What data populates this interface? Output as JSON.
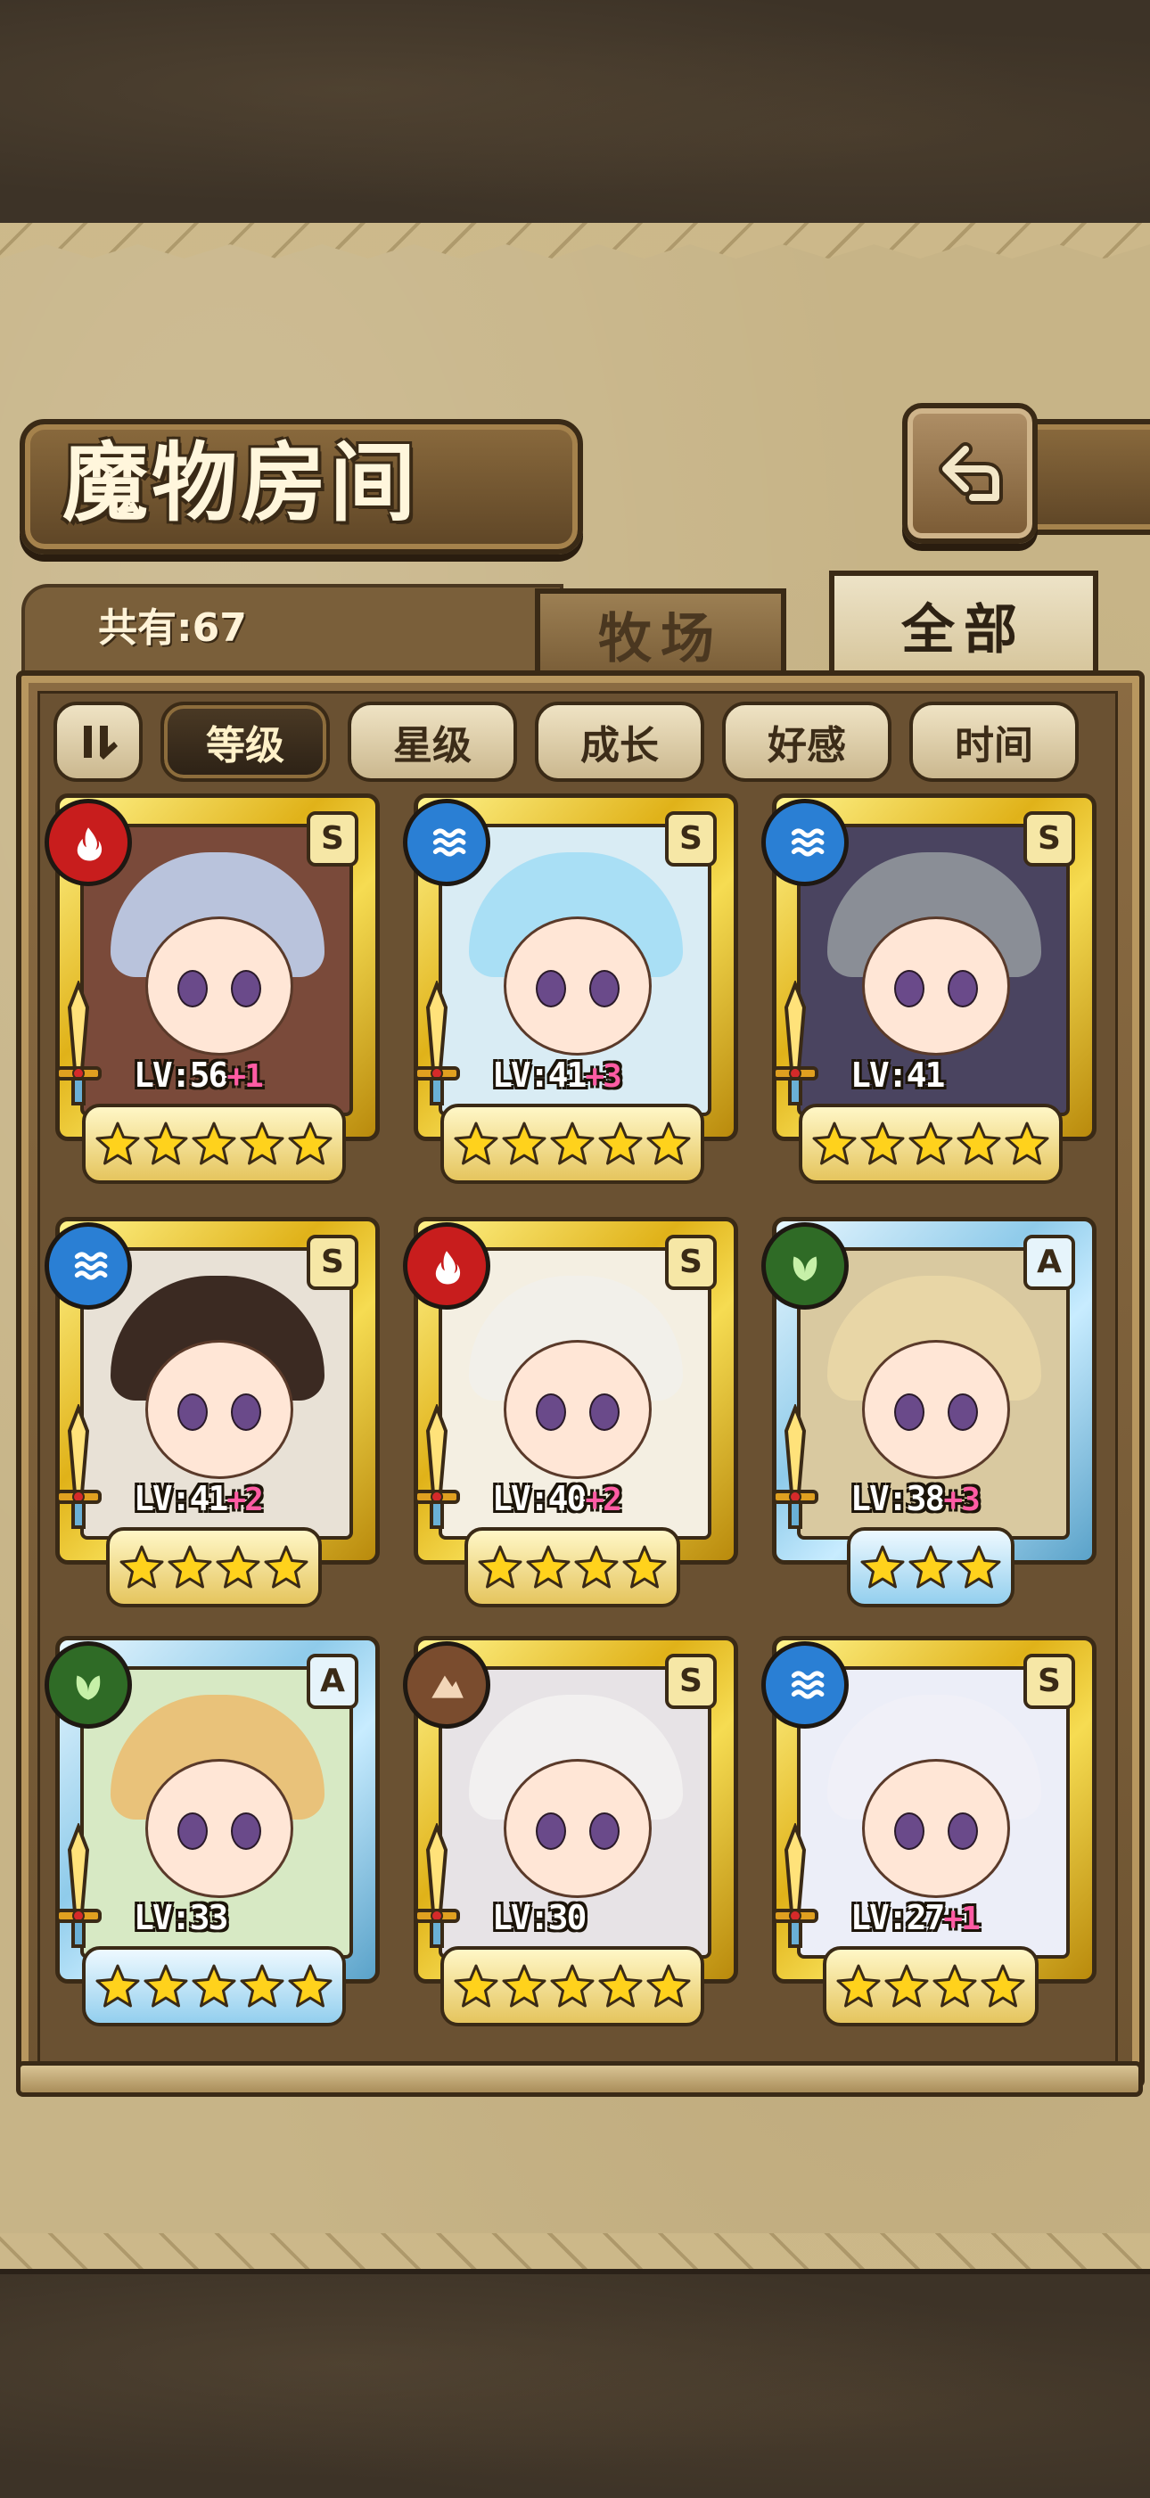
{
  "header": {
    "title": "魔物房间",
    "back_icon": "back-arrow-icon"
  },
  "tabs": [
    {
      "label": "牧场",
      "active": false
    },
    {
      "label": "全部",
      "active": true
    }
  ],
  "count": {
    "label": "共有:67"
  },
  "sort": {
    "toggle_icon": "sort-order-icon",
    "buttons": [
      {
        "label": "等级",
        "active": true
      },
      {
        "label": "星级",
        "active": false
      },
      {
        "label": "成长",
        "active": false
      },
      {
        "label": "好感",
        "active": false
      },
      {
        "label": "时间",
        "active": false
      }
    ]
  },
  "monsters": [
    {
      "element": "fire",
      "rank": "S",
      "lv": "LV:56",
      "plus": "+1",
      "stars": 5,
      "frame": "gold",
      "hair": "#b9c3dc",
      "bg": "#7a4a3a"
    },
    {
      "element": "water",
      "rank": "S",
      "lv": "LV:41",
      "plus": "+3",
      "stars": 5,
      "frame": "gold",
      "hair": "#a9dff5",
      "bg": "#d9ecf4"
    },
    {
      "element": "water",
      "rank": "S",
      "lv": "LV:41",
      "plus": "",
      "stars": 5,
      "frame": "gold",
      "hair": "#8a8e96",
      "bg": "#4a4460"
    },
    {
      "element": "water",
      "rank": "S",
      "lv": "LV:41",
      "plus": "+2",
      "stars": 4,
      "frame": "gold",
      "hair": "#3b2a22",
      "bg": "#e8e1d6"
    },
    {
      "element": "fire",
      "rank": "S",
      "lv": "LV:40",
      "plus": "+2",
      "stars": 4,
      "frame": "gold",
      "hair": "#f2f0ea",
      "bg": "#f4efe2"
    },
    {
      "element": "wood",
      "rank": "A",
      "lv": "LV:38",
      "plus": "+3",
      "stars": 3,
      "frame": "blue",
      "hair": "#e8d6a6",
      "bg": "#d9c9a0"
    },
    {
      "element": "wood",
      "rank": "A",
      "lv": "LV:33",
      "plus": "",
      "stars": 5,
      "frame": "blue",
      "hair": "#e9c27a",
      "bg": "#d7e9c4"
    },
    {
      "element": "earth",
      "rank": "S",
      "lv": "LV:30",
      "plus": "",
      "stars": 5,
      "frame": "gold",
      "hair": "#f2f0f0",
      "bg": "#e7e3e6"
    },
    {
      "element": "water",
      "rank": "S",
      "lv": "LV:27",
      "plus": "+1",
      "stars": 4,
      "frame": "gold",
      "hair": "#f0f0f8",
      "bg": "#eceef8"
    }
  ],
  "colors": {
    "accent": "#e0b219",
    "panel": "#c7b487",
    "dark": "#3a2a16"
  }
}
